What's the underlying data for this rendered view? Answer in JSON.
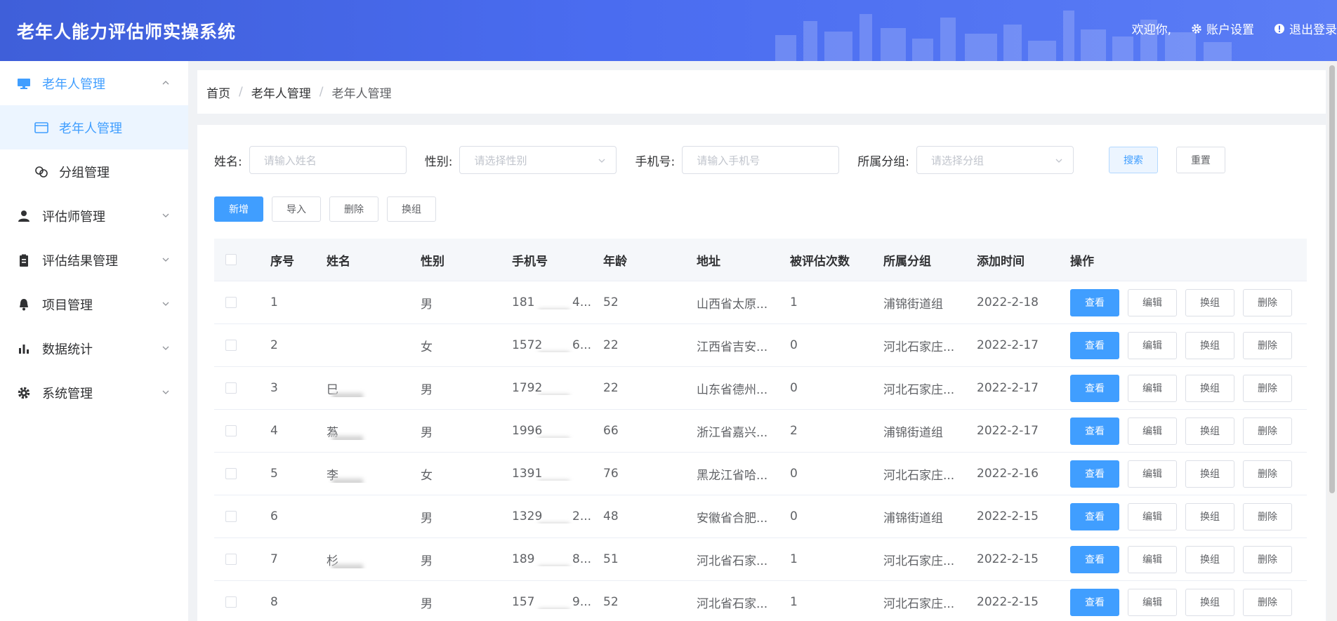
{
  "header": {
    "title": "老年人能力评估师实操系统",
    "welcome": "欢迎你,",
    "account_settings": "账户设置",
    "logout": "退出登录"
  },
  "sidebar": {
    "items": [
      {
        "label": "老年人管理",
        "icon": "monitor-icon",
        "expanded": true
      },
      {
        "label": "评估师管理",
        "icon": "user-icon"
      },
      {
        "label": "评估结果管理",
        "icon": "clipboard-icon"
      },
      {
        "label": "项目管理",
        "icon": "bell-icon"
      },
      {
        "label": "数据统计",
        "icon": "bar-chart-icon"
      },
      {
        "label": "系统管理",
        "icon": "gear-icon"
      }
    ],
    "sub_items": [
      {
        "label": "老年人管理",
        "icon": "list-icon",
        "active": true
      },
      {
        "label": "分组管理",
        "icon": "link-icon"
      }
    ]
  },
  "breadcrumb": [
    "首页",
    "老年人管理",
    "老年人管理"
  ],
  "filters": {
    "name_label": "姓名:",
    "name_placeholder": "请输入姓名",
    "gender_label": "性别:",
    "gender_placeholder": "请选择性别",
    "phone_label": "手机号:",
    "phone_placeholder": "请输入手机号",
    "group_label": "所属分组:",
    "group_placeholder": "请选择分组",
    "search_label": "搜索",
    "reset_label": "重置"
  },
  "actions": {
    "add": "新增",
    "import": "导入",
    "delete": "删除",
    "regroup": "换组"
  },
  "table": {
    "columns": [
      "序号",
      "姓名",
      "性别",
      "手机号",
      "年龄",
      "地址",
      "被评估次数",
      "所属分组",
      "添加时间",
      "操作"
    ],
    "op_labels": {
      "view": "查看",
      "edit": "编辑",
      "regroup": "换组",
      "delete": "删除"
    },
    "rows": [
      {
        "no": "1",
        "name": "",
        "gender": "男",
        "phone": "181",
        "phone_tail": "4...",
        "age": "52",
        "address": "山西省太原...",
        "count": "1",
        "group": "浦锦街道组",
        "date": "2022-2-18"
      },
      {
        "no": "2",
        "name": "",
        "gender": "女",
        "phone": "1572",
        "phone_tail": "6...",
        "age": "22",
        "address": "江西省吉安...",
        "count": "0",
        "group": "河北石家庄...",
        "date": "2022-2-17"
      },
      {
        "no": "3",
        "name": "巳",
        "gender": "男",
        "phone": "1792",
        "phone_tail": "",
        "age": "22",
        "address": "山东省德州...",
        "count": "0",
        "group": "河北石家庄...",
        "date": "2022-2-17"
      },
      {
        "no": "4",
        "name": "蒍",
        "gender": "男",
        "phone": "1996",
        "phone_tail": "",
        "age": "66",
        "address": "浙江省嘉兴...",
        "count": "2",
        "group": "浦锦街道组",
        "date": "2022-2-17"
      },
      {
        "no": "5",
        "name": "李",
        "gender": "女",
        "phone": "1391",
        "phone_tail": "",
        "age": "76",
        "address": "黑龙江省哈...",
        "count": "0",
        "group": "河北石家庄...",
        "date": "2022-2-16"
      },
      {
        "no": "6",
        "name": "",
        "gender": "男",
        "phone": "1329",
        "phone_tail": "2...",
        "age": "48",
        "address": "安徽省合肥...",
        "count": "0",
        "group": "浦锦街道组",
        "date": "2022-2-15"
      },
      {
        "no": "7",
        "name": "杉",
        "gender": "男",
        "phone": "189",
        "phone_tail": "8...",
        "age": "51",
        "address": "河北省石家...",
        "count": "1",
        "group": "河北石家庄...",
        "date": "2022-2-15"
      },
      {
        "no": "8",
        "name": "",
        "gender": "男",
        "phone": "157",
        "phone_tail": "9...",
        "age": "52",
        "address": "河北省石家...",
        "count": "1",
        "group": "河北石家庄...",
        "date": "2022-2-15"
      }
    ]
  },
  "colors": {
    "primary": "#409eff",
    "header_gradient_start": "#3f5fd9",
    "header_gradient_end": "#5b7df5"
  }
}
